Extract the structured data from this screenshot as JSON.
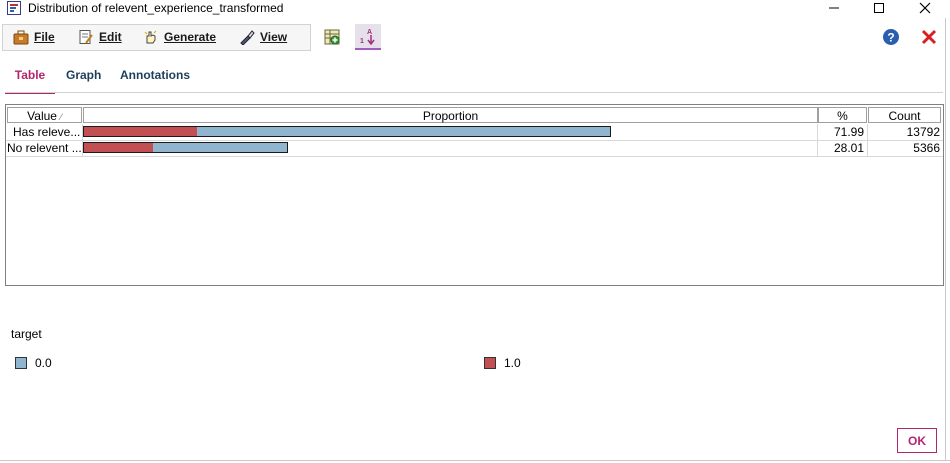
{
  "window": {
    "title": "Distribution of relevent_experience_transformed"
  },
  "menu": {
    "file": "File",
    "edit": "Edit",
    "generate": "Generate",
    "view": "View"
  },
  "tabs": [
    "Table",
    "Graph",
    "Annotations"
  ],
  "table": {
    "headers": {
      "value": "Value",
      "proportion": "Proportion",
      "percent": "%",
      "count": "Count"
    },
    "rows": [
      {
        "value": "Has releve...",
        "percent": "71.99",
        "count": "13792",
        "proportion": 0.7199,
        "target_1_share": 0.2137
      },
      {
        "value": "No relevent ...",
        "percent": "28.01",
        "count": "5366",
        "proportion": 0.2801,
        "target_1_share": 0.3385
      }
    ]
  },
  "legend": {
    "title": "target",
    "items": [
      {
        "label": "0.0",
        "color": "#8fb5cf"
      },
      {
        "label": "1.0",
        "color": "#c25052"
      }
    ]
  },
  "ok_button": "OK",
  "colors": {
    "accent": "#b3266f",
    "bar_target_0": "#8fb5cf",
    "bar_target_1": "#c25052"
  }
}
